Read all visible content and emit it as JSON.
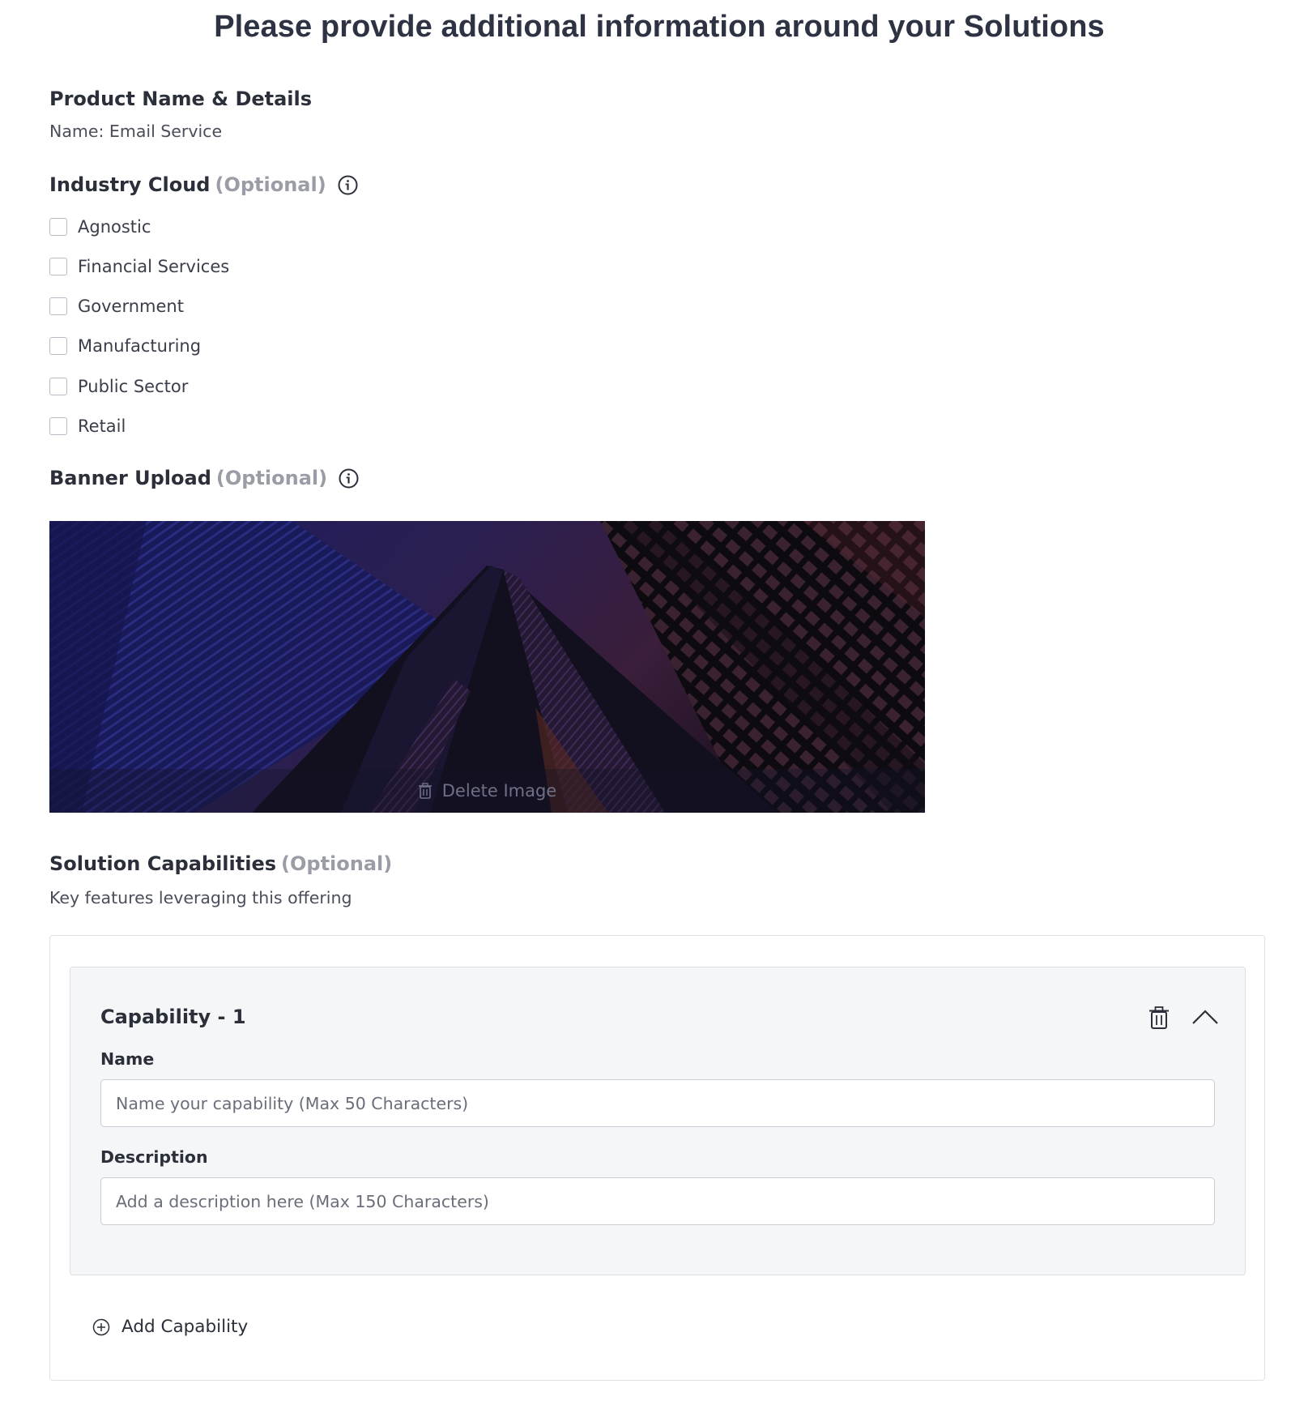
{
  "page": {
    "title": "Please provide additional information around your Solutions"
  },
  "product": {
    "heading": "Product Name & Details",
    "name_line": "Name: Email Service"
  },
  "industry_cloud": {
    "heading": "Industry Cloud",
    "optional": "(Optional)",
    "info_icon": "info-circle-icon",
    "options": [
      {
        "label": "Agnostic",
        "checked": false
      },
      {
        "label": "Financial Services",
        "checked": false
      },
      {
        "label": "Government",
        "checked": false
      },
      {
        "label": "Manufacturing",
        "checked": false
      },
      {
        "label": "Public Sector",
        "checked": false
      },
      {
        "label": "Retail",
        "checked": false
      }
    ]
  },
  "banner": {
    "heading": "Banner Upload",
    "optional": "(Optional)",
    "info_icon": "info-circle-icon",
    "delete_label": "Delete Image",
    "delete_icon": "trash-icon"
  },
  "capabilities": {
    "heading": "Solution Capabilities",
    "optional": "(Optional)",
    "subtitle": "Key features leveraging this offering",
    "items": [
      {
        "title": "Capability - 1",
        "name_label": "Name",
        "name_value": "",
        "name_placeholder": "Name your capability (Max 50 Characters)",
        "description_label": "Description",
        "description_value": "",
        "description_placeholder": "Add a description here (Max 150 Characters)"
      }
    ],
    "add_label": "Add Capability"
  },
  "colors": {
    "heading": "#2b2f3a",
    "optional": "#9a9ca6",
    "card_bg": "#f5f6f7",
    "border": "#dfe1e6"
  }
}
